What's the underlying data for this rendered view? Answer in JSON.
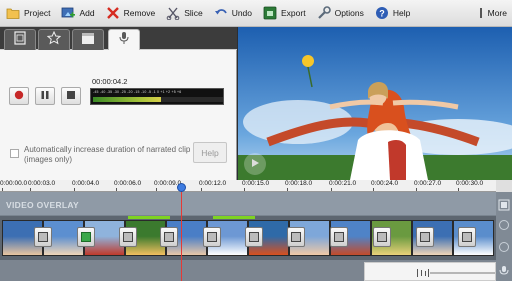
{
  "toolbar": {
    "project": "Project",
    "add": "Add",
    "remove": "Remove",
    "slice": "Slice",
    "undo": "Undo",
    "export": "Export",
    "options": "Options",
    "help": "Help",
    "more": "More"
  },
  "narration": {
    "tabs": [
      "clip-tab",
      "favorite-tab",
      "clapper-tab",
      "microphone-tab"
    ],
    "time": "00:00:04.2",
    "meter_scale": "-45 -40 -35 -30 -25 -20 -15 -10 -5 -1 0 +1 +2 +5 +6",
    "meter_level": 0.52,
    "checkbox_label": "Automatically increase duration of narrated clip (images only)",
    "help_label": "Help"
  },
  "timeline": {
    "ticks": [
      "0:00:00.0",
      "0:00:03.0",
      "0:00:04.0",
      "0:00:06.0",
      "0:00:09.0",
      "0:00:12.0",
      "0:00:15.0",
      "0:00:18.0",
      "0:00:21.0",
      "0:00:24.0",
      "0:00:27.0",
      "0:00:30.0"
    ],
    "overlay_label": "VIDEO OVERLAY",
    "playhead": "0:00:09.0"
  },
  "colors": {
    "accent_red": "#e53935",
    "green_marker": "#7ed321",
    "playhead_knob": "#3d7be0"
  }
}
